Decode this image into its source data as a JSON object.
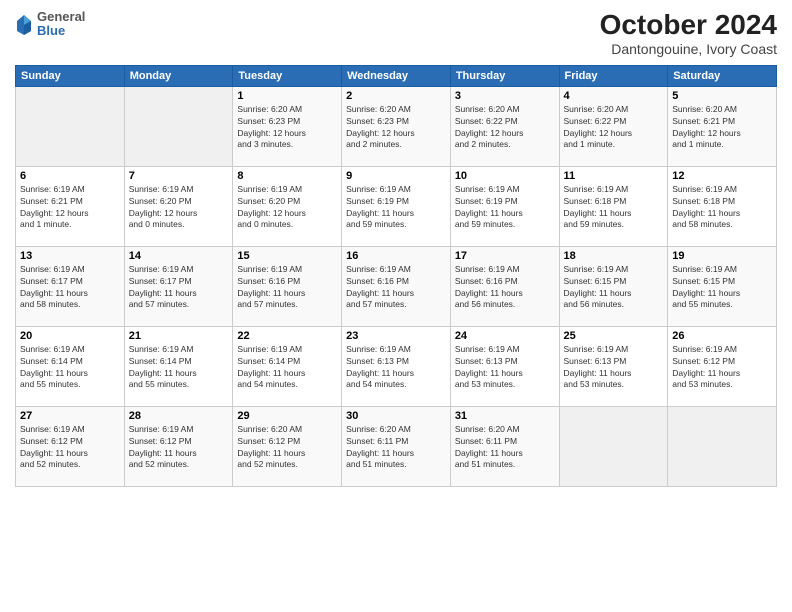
{
  "logo": {
    "line1": "General",
    "line2": "Blue"
  },
  "title": "October 2024",
  "subtitle": "Dantongouine, Ivory Coast",
  "days_of_week": [
    "Sunday",
    "Monday",
    "Tuesday",
    "Wednesday",
    "Thursday",
    "Friday",
    "Saturday"
  ],
  "weeks": [
    [
      {
        "day": "",
        "info": ""
      },
      {
        "day": "",
        "info": ""
      },
      {
        "day": "1",
        "info": "Sunrise: 6:20 AM\nSunset: 6:23 PM\nDaylight: 12 hours\nand 3 minutes."
      },
      {
        "day": "2",
        "info": "Sunrise: 6:20 AM\nSunset: 6:23 PM\nDaylight: 12 hours\nand 2 minutes."
      },
      {
        "day": "3",
        "info": "Sunrise: 6:20 AM\nSunset: 6:22 PM\nDaylight: 12 hours\nand 2 minutes."
      },
      {
        "day": "4",
        "info": "Sunrise: 6:20 AM\nSunset: 6:22 PM\nDaylight: 12 hours\nand 1 minute."
      },
      {
        "day": "5",
        "info": "Sunrise: 6:20 AM\nSunset: 6:21 PM\nDaylight: 12 hours\nand 1 minute."
      }
    ],
    [
      {
        "day": "6",
        "info": "Sunrise: 6:19 AM\nSunset: 6:21 PM\nDaylight: 12 hours\nand 1 minute."
      },
      {
        "day": "7",
        "info": "Sunrise: 6:19 AM\nSunset: 6:20 PM\nDaylight: 12 hours\nand 0 minutes."
      },
      {
        "day": "8",
        "info": "Sunrise: 6:19 AM\nSunset: 6:20 PM\nDaylight: 12 hours\nand 0 minutes."
      },
      {
        "day": "9",
        "info": "Sunrise: 6:19 AM\nSunset: 6:19 PM\nDaylight: 11 hours\nand 59 minutes."
      },
      {
        "day": "10",
        "info": "Sunrise: 6:19 AM\nSunset: 6:19 PM\nDaylight: 11 hours\nand 59 minutes."
      },
      {
        "day": "11",
        "info": "Sunrise: 6:19 AM\nSunset: 6:18 PM\nDaylight: 11 hours\nand 59 minutes."
      },
      {
        "day": "12",
        "info": "Sunrise: 6:19 AM\nSunset: 6:18 PM\nDaylight: 11 hours\nand 58 minutes."
      }
    ],
    [
      {
        "day": "13",
        "info": "Sunrise: 6:19 AM\nSunset: 6:17 PM\nDaylight: 11 hours\nand 58 minutes."
      },
      {
        "day": "14",
        "info": "Sunrise: 6:19 AM\nSunset: 6:17 PM\nDaylight: 11 hours\nand 57 minutes."
      },
      {
        "day": "15",
        "info": "Sunrise: 6:19 AM\nSunset: 6:16 PM\nDaylight: 11 hours\nand 57 minutes."
      },
      {
        "day": "16",
        "info": "Sunrise: 6:19 AM\nSunset: 6:16 PM\nDaylight: 11 hours\nand 57 minutes."
      },
      {
        "day": "17",
        "info": "Sunrise: 6:19 AM\nSunset: 6:16 PM\nDaylight: 11 hours\nand 56 minutes."
      },
      {
        "day": "18",
        "info": "Sunrise: 6:19 AM\nSunset: 6:15 PM\nDaylight: 11 hours\nand 56 minutes."
      },
      {
        "day": "19",
        "info": "Sunrise: 6:19 AM\nSunset: 6:15 PM\nDaylight: 11 hours\nand 55 minutes."
      }
    ],
    [
      {
        "day": "20",
        "info": "Sunrise: 6:19 AM\nSunset: 6:14 PM\nDaylight: 11 hours\nand 55 minutes."
      },
      {
        "day": "21",
        "info": "Sunrise: 6:19 AM\nSunset: 6:14 PM\nDaylight: 11 hours\nand 55 minutes."
      },
      {
        "day": "22",
        "info": "Sunrise: 6:19 AM\nSunset: 6:14 PM\nDaylight: 11 hours\nand 54 minutes."
      },
      {
        "day": "23",
        "info": "Sunrise: 6:19 AM\nSunset: 6:13 PM\nDaylight: 11 hours\nand 54 minutes."
      },
      {
        "day": "24",
        "info": "Sunrise: 6:19 AM\nSunset: 6:13 PM\nDaylight: 11 hours\nand 53 minutes."
      },
      {
        "day": "25",
        "info": "Sunrise: 6:19 AM\nSunset: 6:13 PM\nDaylight: 11 hours\nand 53 minutes."
      },
      {
        "day": "26",
        "info": "Sunrise: 6:19 AM\nSunset: 6:12 PM\nDaylight: 11 hours\nand 53 minutes."
      }
    ],
    [
      {
        "day": "27",
        "info": "Sunrise: 6:19 AM\nSunset: 6:12 PM\nDaylight: 11 hours\nand 52 minutes."
      },
      {
        "day": "28",
        "info": "Sunrise: 6:19 AM\nSunset: 6:12 PM\nDaylight: 11 hours\nand 52 minutes."
      },
      {
        "day": "29",
        "info": "Sunrise: 6:20 AM\nSunset: 6:12 PM\nDaylight: 11 hours\nand 52 minutes."
      },
      {
        "day": "30",
        "info": "Sunrise: 6:20 AM\nSunset: 6:11 PM\nDaylight: 11 hours\nand 51 minutes."
      },
      {
        "day": "31",
        "info": "Sunrise: 6:20 AM\nSunset: 6:11 PM\nDaylight: 11 hours\nand 51 minutes."
      },
      {
        "day": "",
        "info": ""
      },
      {
        "day": "",
        "info": ""
      }
    ]
  ]
}
